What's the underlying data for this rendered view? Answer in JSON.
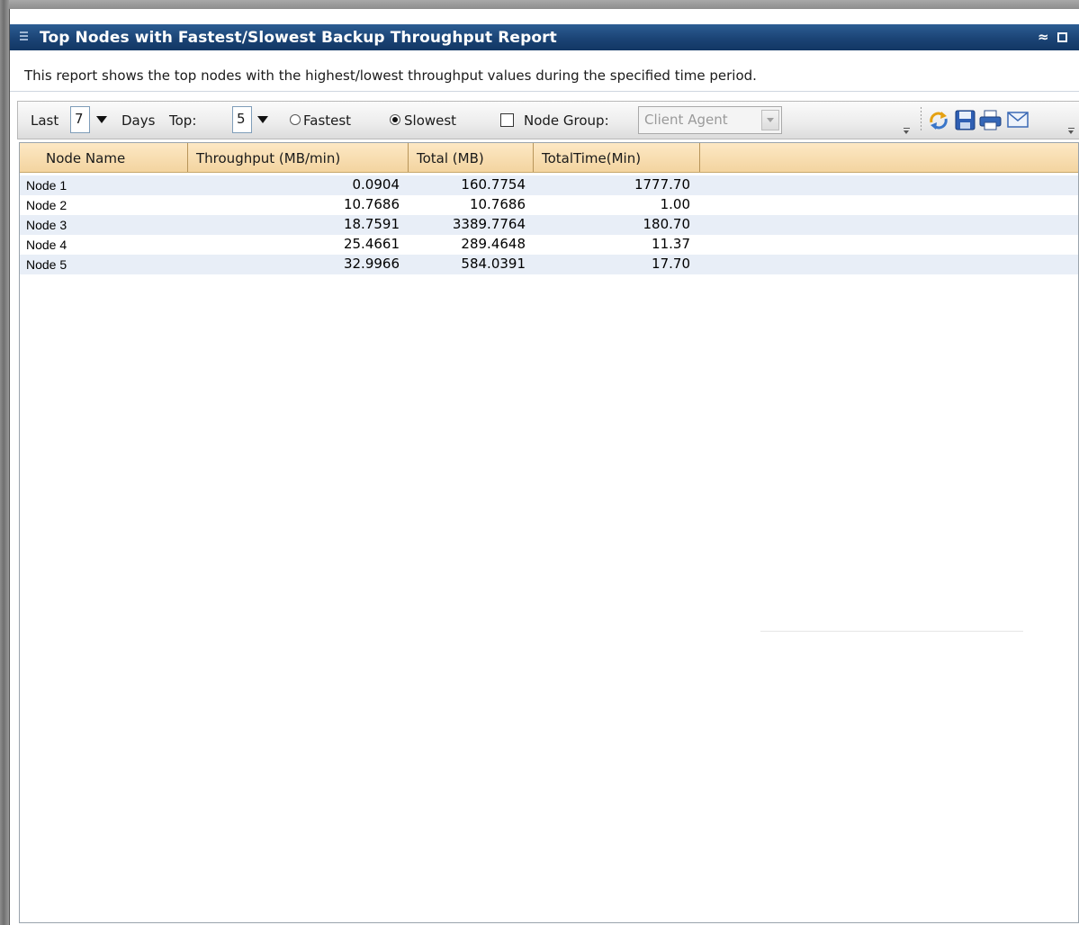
{
  "window": {
    "title": "Top Nodes with Fastest/Slowest Backup Throughput Report",
    "collapse_glyph": "≈",
    "icons": [
      "grip-icon",
      "collapse-icon",
      "maximize-icon"
    ]
  },
  "description": "This report shows the top nodes with the highest/lowest throughput values during the specified time period.",
  "toolbar": {
    "last_label": "Last",
    "last_value": "7",
    "days_label": "Days",
    "top_label": "Top:",
    "top_value": "5",
    "fastest_label": "Fastest",
    "slowest_label": "Slowest",
    "mode_selected": "Slowest",
    "node_group_label": "Node Group:",
    "node_group_checked": false,
    "node_group_value": "Client Agent",
    "node_group_enabled": false,
    "icons": [
      "refresh-icon",
      "save-icon",
      "print-icon",
      "email-icon"
    ]
  },
  "table": {
    "columns": [
      "Node Name",
      "Throughput (MB/min)",
      "Total (MB)",
      "TotalTime(Min)"
    ],
    "rows": [
      {
        "name": "Node 1",
        "throughput": "0.0904",
        "total": "160.7754",
        "time": "1777.70"
      },
      {
        "name": "Node 2",
        "throughput": "10.7686",
        "total": "10.7686",
        "time": "1.00"
      },
      {
        "name": "Node 3",
        "throughput": "18.7591",
        "total": "3389.7764",
        "time": "180.70"
      },
      {
        "name": "Node 4",
        "throughput": "25.4661",
        "total": "289.4648",
        "time": "11.37"
      },
      {
        "name": "Node 5",
        "throughput": "32.9966",
        "total": "584.0391",
        "time": "17.70"
      }
    ]
  },
  "colors": {
    "title_bar": "#1b4475",
    "header_bg": "#f3d4a0",
    "row_alt": "#e8eef7"
  }
}
